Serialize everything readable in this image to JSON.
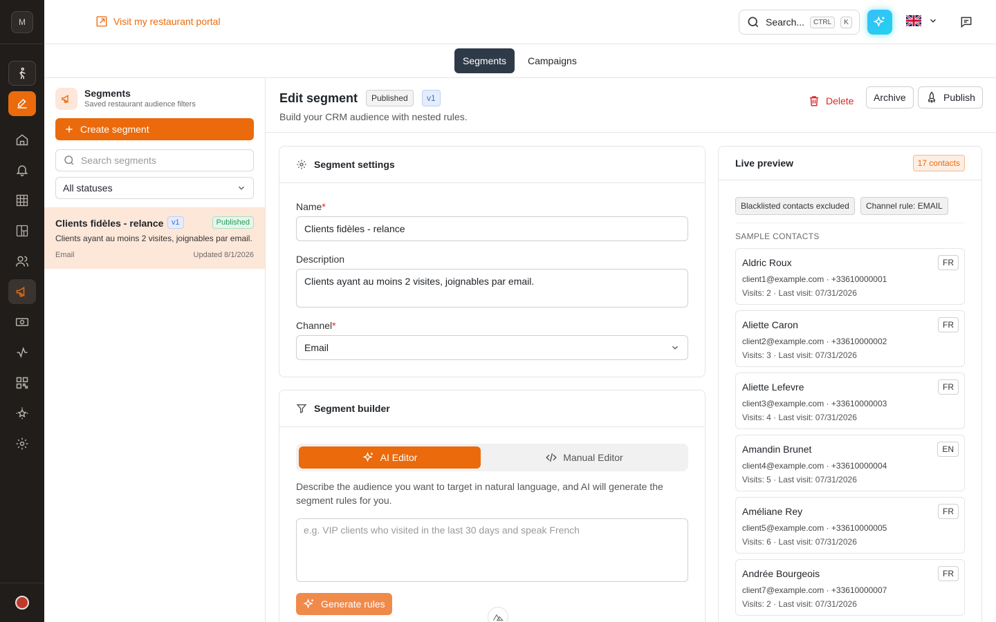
{
  "app": {
    "workspace_initial": "M",
    "portal_link": "Visit my restaurant portal",
    "search": {
      "label": "Search...",
      "kbd1": "CTRL",
      "kbd2": "K"
    }
  },
  "tabs": [
    {
      "label": "Segments",
      "active": true
    },
    {
      "label": "Campaigns",
      "active": false
    }
  ],
  "sidebar": {
    "title": "Segments",
    "subtitle": "Saved restaurant audience filters",
    "create_label": "Create segment",
    "search_placeholder": "Search segments",
    "status_filter": "All statuses",
    "items": [
      {
        "name": "Clients fidèles - relance",
        "version": "v1",
        "status": "Published",
        "description": "Clients ayant au moins 2 visites, joignables par email.",
        "channel": "Email",
        "updated": "Updated 8/1/2026"
      }
    ]
  },
  "editor": {
    "title": "Edit segment",
    "status": "Published",
    "version": "v1",
    "subtitle": "Build your CRM audience with nested rules.",
    "delete_label": "Delete",
    "archive_label": "Archive",
    "publish_label": "Publish"
  },
  "settings": {
    "title": "Segment settings",
    "name_label": "Name",
    "name_value": "Clients fidèles - relance",
    "description_label": "Description",
    "description_value": "Clients ayant au moins 2 visites, joignables par email.",
    "channel_label": "Channel",
    "channel_value": "Email"
  },
  "builder": {
    "title": "Segment builder",
    "ai_tab": "AI Editor",
    "manual_tab": "Manual Editor",
    "help": "Describe the audience you want to target in natural language, and AI will generate the segment rules for you.",
    "prompt_placeholder": "e.g. VIP clients who visited in the last 30 days and speak French",
    "generate_label": "Generate rules"
  },
  "preview": {
    "title": "Live preview",
    "count": "17 contacts",
    "chips": [
      "Blacklisted contacts excluded",
      "Channel rule: EMAIL"
    ],
    "samples_label": "SAMPLE CONTACTS",
    "contacts": [
      {
        "name": "Aldric Roux",
        "lang": "FR",
        "contact": "client1@example.com · +33610000001",
        "visits": "Visits: 2 · Last visit: 07/31/2026"
      },
      {
        "name": "Aliette Caron",
        "lang": "FR",
        "contact": "client2@example.com · +33610000002",
        "visits": "Visits: 3 · Last visit: 07/31/2026"
      },
      {
        "name": "Aliette Lefevre",
        "lang": "FR",
        "contact": "client3@example.com · +33610000003",
        "visits": "Visits: 4 · Last visit: 07/31/2026"
      },
      {
        "name": "Amandin Brunet",
        "lang": "EN",
        "contact": "client4@example.com · +33610000004",
        "visits": "Visits: 5 · Last visit: 07/31/2026"
      },
      {
        "name": "Améliane Rey",
        "lang": "FR",
        "contact": "client5@example.com · +33610000005",
        "visits": "Visits: 6 · Last visit: 07/31/2026"
      },
      {
        "name": "Andrée Bourgeois",
        "lang": "FR",
        "contact": "client7@example.com · +33610000007",
        "visits": "Visits: 2 · Last visit: 07/31/2026"
      }
    ]
  },
  "colors": {
    "accent": "#ea6a0c",
    "rail": "#201d1b",
    "danger": "#e02424"
  }
}
